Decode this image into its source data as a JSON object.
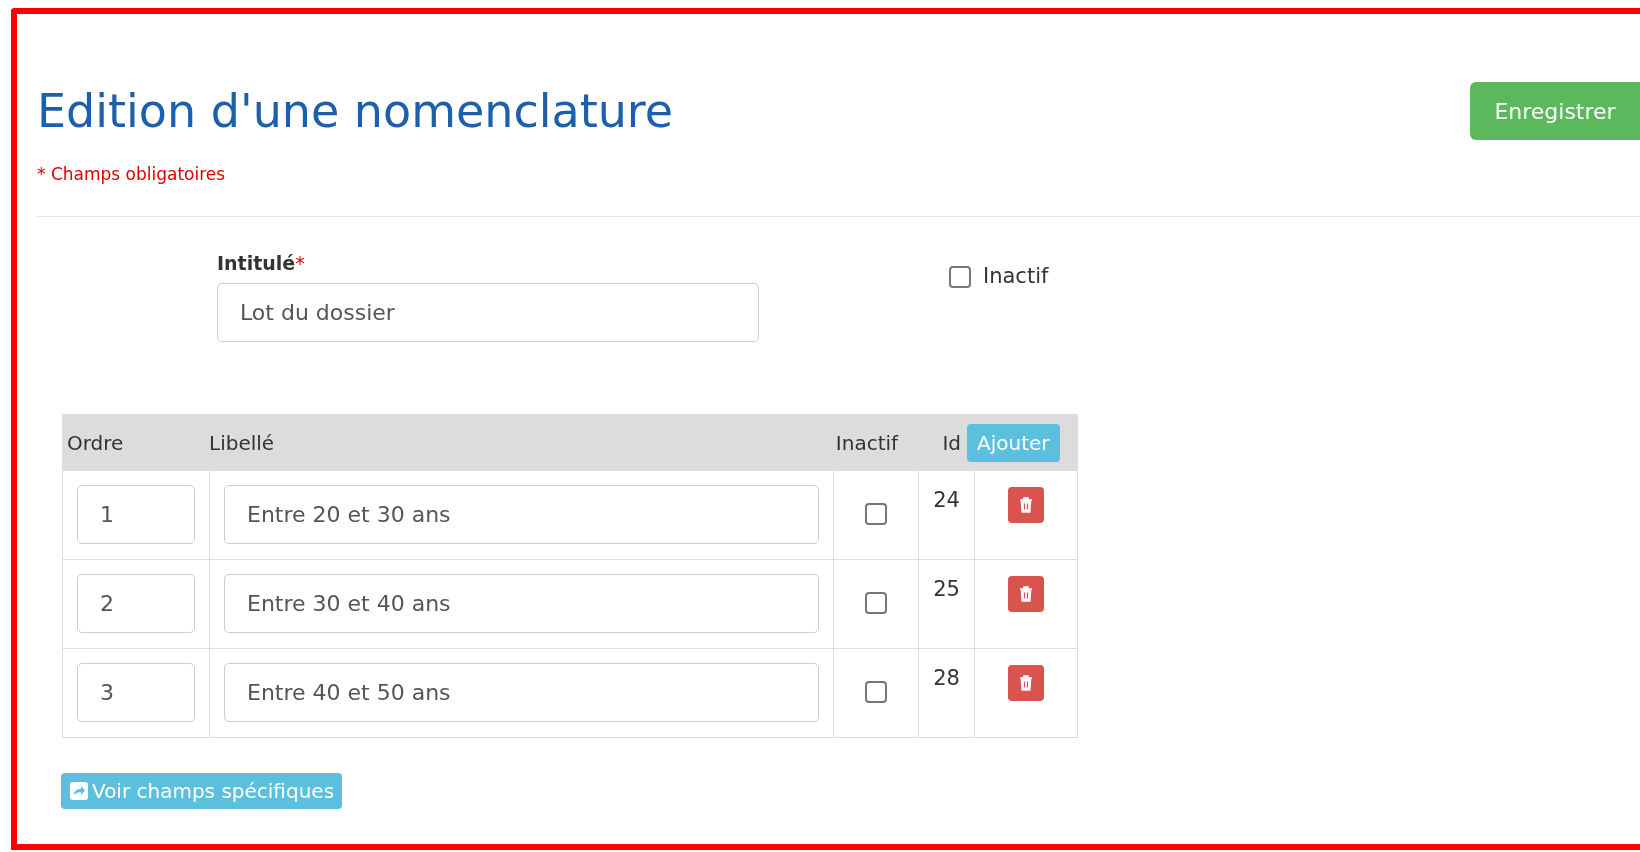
{
  "page": {
    "title": "Edition d'une nomenclature",
    "required_note": "* Champs obligatoires",
    "save_button": "Enregistrer"
  },
  "form": {
    "label": "Intitulé",
    "required_mark": "*",
    "value": "Lot du dossier",
    "inactive": {
      "label": "Inactif",
      "checked": false
    }
  },
  "table": {
    "columns": [
      "Ordre",
      "Libellé",
      "Inactif",
      "Id"
    ],
    "add_button": "Ajouter",
    "rows": [
      {
        "order": "1",
        "label": "Entre 20 et 30 ans",
        "inactive": false,
        "id": "24"
      },
      {
        "order": "2",
        "label": "Entre 30 et 40 ans",
        "inactive": false,
        "id": "25"
      },
      {
        "order": "3",
        "label": "Entre 40 et 50 ans",
        "inactive": false,
        "id": "28"
      }
    ]
  },
  "footer_button": "Voir champs spécifiques"
}
